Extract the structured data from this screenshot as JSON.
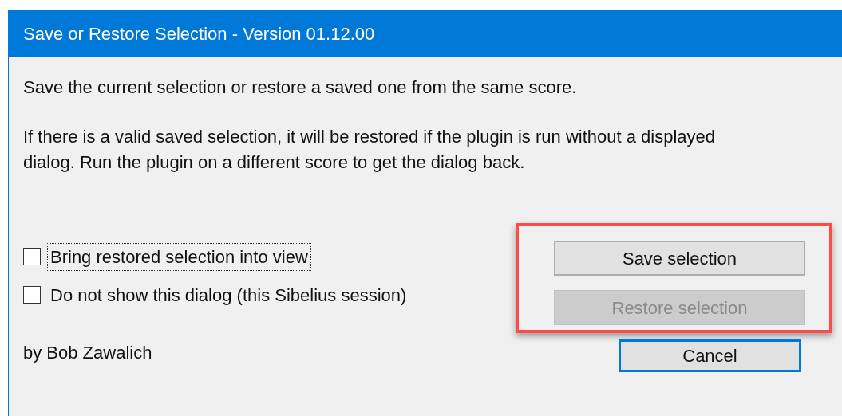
{
  "window": {
    "title": "Save or Restore Selection - Version 01.12.00"
  },
  "paragraphs": [
    "Save the current selection or restore a saved one from the same score.",
    "If there is a valid saved selection, it will be restored if the plugin is run without a displayed dialog. Run the plugin on a different score to get the dialog back."
  ],
  "checkboxes": [
    {
      "label": "Bring restored selection into view",
      "checked": false,
      "focused": true
    },
    {
      "label": "Do not show this dialog (this Sibelius session)",
      "checked": false,
      "focused": false
    }
  ],
  "byline": "by Bob Zawalich",
  "buttons": [
    {
      "label": "Save selection",
      "disabled": false,
      "default": false
    },
    {
      "label": "Restore selection",
      "disabled": true,
      "default": false
    },
    {
      "label": "Cancel",
      "disabled": false,
      "default": true
    }
  ],
  "highlight_frame": true
}
